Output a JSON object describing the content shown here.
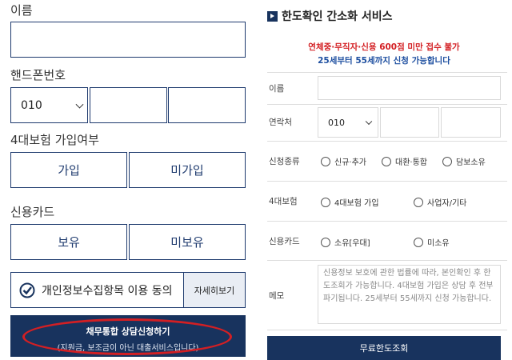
{
  "left": {
    "name_label": "이름",
    "phone_label": "핸드폰번호",
    "phone_prefix": "010",
    "insurance_label": "4대보험 가입여부",
    "insurance_yes": "가입",
    "insurance_no": "미가입",
    "card_label": "신용카드",
    "card_yes": "보유",
    "card_no": "미보유",
    "consent_text": "개인정보수집항목 이용 동의",
    "consent_detail": "자세히보기",
    "cta_title": "채무통합 상담신청하기",
    "cta_sub": "(지원금, 보조금이 아닌 대출서비스입니다)"
  },
  "right": {
    "title": "한도확인 간소화 서비스",
    "warn1": "연체중·무직자·신용 600점 미만 접수 불가",
    "warn2": "25세부터 55세까지 신청 가능합니다",
    "name_label": "이름",
    "contact_label": "연락처",
    "contact_prefix": "010",
    "type_label": "신청종류",
    "type_opt1": "신규·추가",
    "type_opt2": "대환·통합",
    "type_opt3": "담보소유",
    "ins_label": "4대보험",
    "ins_opt1": "4대보험 가입",
    "ins_opt2": "사업자/기타",
    "card_label": "신용카드",
    "card_opt1": "소유[우대]",
    "card_opt2": "미소유",
    "memo_label": "메모",
    "memo_text": "신용정보 보호에 관한 법률에 따라, 본인확인 후 한도조회가 가능합니다. 4대보험 가입은 상담 후 전부 파기됩니다. 25세부터 55세까지 신청 가능합니다.",
    "submit": "무료한도조회"
  },
  "colors": {
    "navy": "#18335e",
    "red": "#d31f23",
    "warn_blue": "#1e4fa0"
  }
}
